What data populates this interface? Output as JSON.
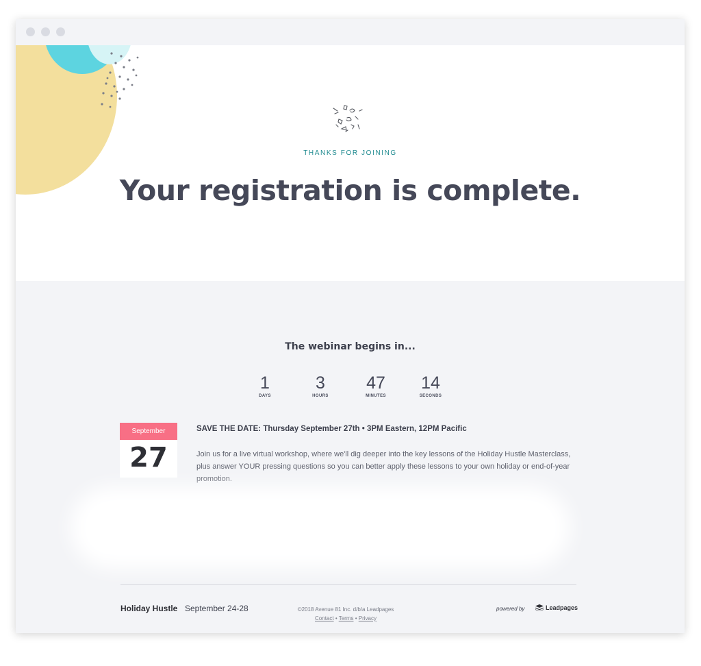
{
  "hero": {
    "kicker": "THANKS FOR JOINING",
    "headline": "Your registration is complete.",
    "icons": {
      "confetti": "confetti-icon"
    },
    "colors": {
      "yellow": "#f3df9d",
      "cyan": "#5dd4e0",
      "kicker": "#1e8a8f"
    }
  },
  "countdown": {
    "heading": "The webinar begins in...",
    "units": [
      {
        "value": "1",
        "label": "DAYS"
      },
      {
        "value": "3",
        "label": "HOURS"
      },
      {
        "value": "47",
        "label": "MINUTES"
      },
      {
        "value": "14",
        "label": "SECONDS"
      }
    ]
  },
  "event": {
    "calendar": {
      "month": "September",
      "day": "27",
      "color": "#f86f85"
    },
    "save_the_date": "SAVE THE DATE: Thursday September 27th • 3PM Eastern, 12PM Pacific",
    "description": "Join us for a live virtual workshop, where we'll dig deeper into the key lessons of the Holiday Hustle Masterclass, plus answer YOUR pressing questions so you can better apply these lessons to your own holiday or end-of-year promotion."
  },
  "footer": {
    "brand": "Holiday Hustle",
    "dates": "September 24-28",
    "copyright": "©2018 Avenue 81 Inc. d/b/a Leadpages",
    "links": {
      "contact": "Contact",
      "terms": "Terms",
      "privacy": "Privacy"
    },
    "powered_by": "powered by",
    "provider": "Leadpages",
    "icons": {
      "provider_logo": "leadpages-logo-icon"
    }
  }
}
